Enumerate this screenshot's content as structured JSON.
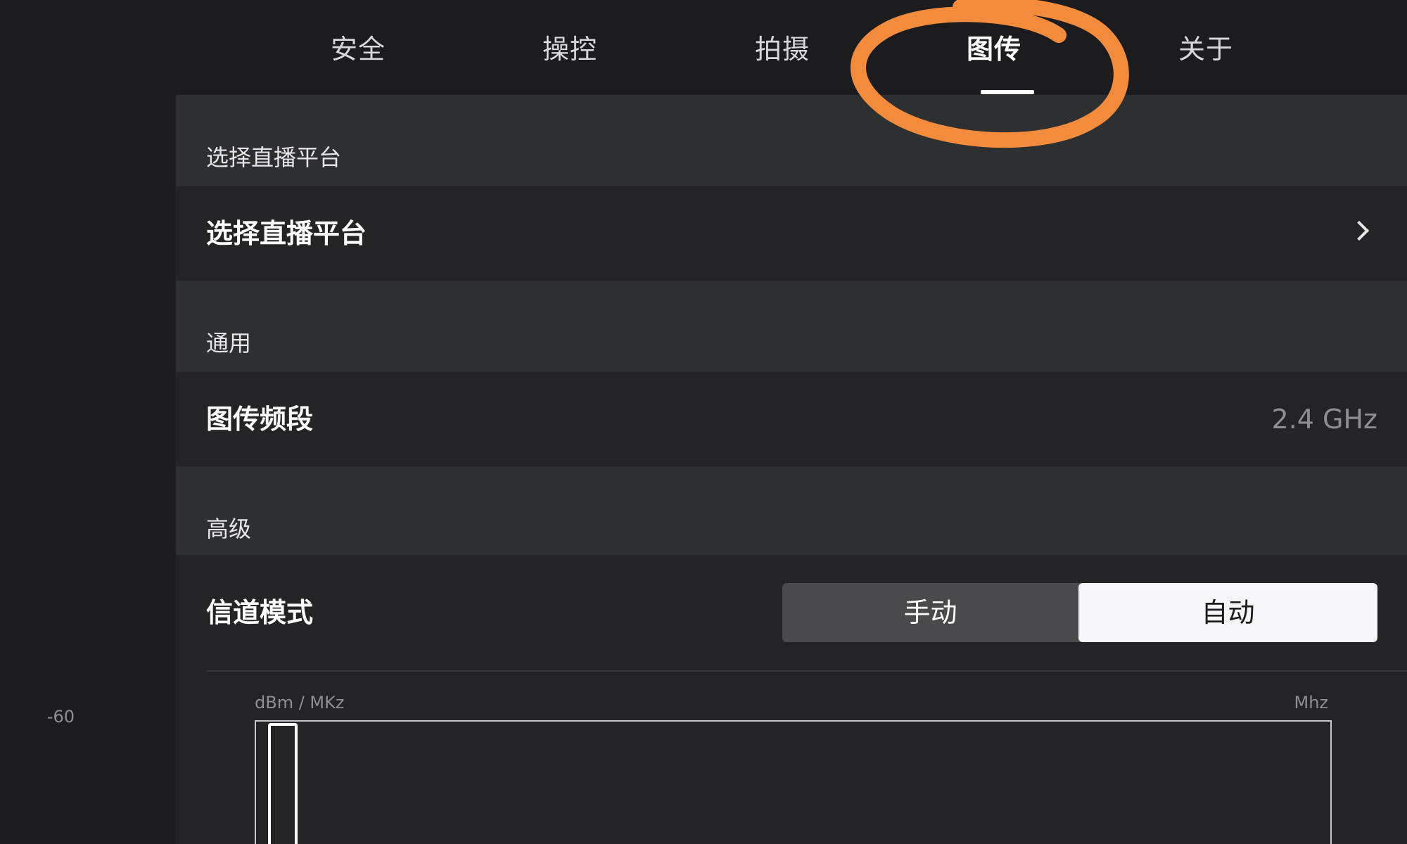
{
  "tabs": [
    {
      "label": "安全",
      "active": false
    },
    {
      "label": "操控",
      "active": false
    },
    {
      "label": "拍摄",
      "active": false
    },
    {
      "label": "图传",
      "active": true
    },
    {
      "label": "关于",
      "active": false
    }
  ],
  "sections": {
    "live": {
      "header": "选择直播平台",
      "row_title": "选择直播平台"
    },
    "general": {
      "header": "通用",
      "row_title": "图传频段",
      "row_value": "2.4 GHz"
    },
    "advanced": {
      "header": "高级",
      "channel_title": "信道模式",
      "segmented": {
        "options": [
          "手动",
          "自动"
        ],
        "selected": "自动"
      }
    }
  },
  "spectrum": {
    "y_unit": "dBm / MKz",
    "x_unit": "Mhz",
    "y_tick": "-60"
  },
  "colors": {
    "accent_annotation": "#f28c3c",
    "active_tab": "#ffffff",
    "background": "#1c1c1e",
    "panel": "#2c2c2e",
    "row": "#242426",
    "muted_text": "#8e8e93"
  },
  "icons": {
    "row_chevron": "chevron-right-icon"
  }
}
